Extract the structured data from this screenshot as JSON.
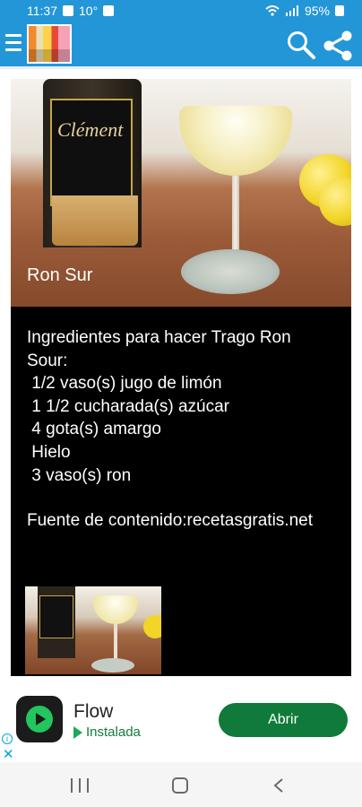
{
  "status_bar": {
    "time": "11:37",
    "temperature": "10°",
    "battery": "95%"
  },
  "app_bar": {
    "menu_icon": "menu-icon",
    "search_icon": "search-icon",
    "share_icon": "share-icon"
  },
  "recipe": {
    "hero_caption": "Ron Sur",
    "ingredients_title_line1": "Ingredientes para hacer Trago Ron",
    "ingredients_title_line2": "Sour:",
    "ingredients": [
      " 1/2 vaso(s) jugo de limón",
      " 1 1/2 cucharada(s) azúcar",
      " 4 gota(s) amargo",
      " Hielo",
      " 3 vaso(s) ron"
    ],
    "source_line1": "Fuente de",
    "source_line2": "contenido:recetasgratis.net",
    "bottle_brand": "Clément"
  },
  "ad": {
    "app_name": "Flow",
    "status": "Instalada",
    "button_label": "Abrir",
    "info_icon": "info-icon",
    "close_icon": "close-icon"
  },
  "colors": {
    "app_bar": "#2396d8",
    "content_background": "#000000",
    "ad_button": "#0f7a39"
  }
}
